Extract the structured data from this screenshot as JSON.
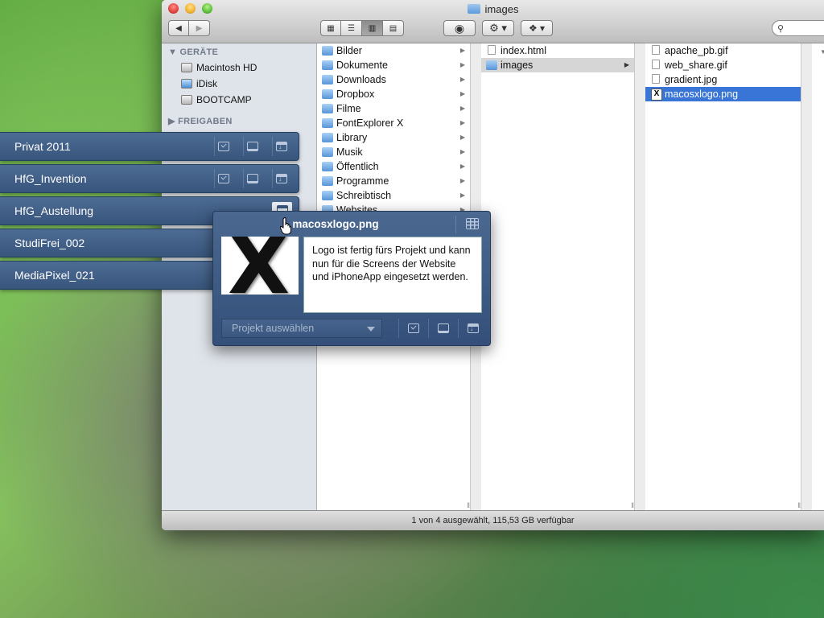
{
  "window": {
    "title": "images",
    "status": "1 von 4 ausgewählt, 115,53 GB verfügbar"
  },
  "sidebar": {
    "sections": [
      {
        "label": "GERÄTE",
        "items": [
          "Macintosh HD",
          "iDisk",
          "BOOTCAMP"
        ]
      },
      {
        "label": "FREIGABEN",
        "items": []
      }
    ]
  },
  "columns": [
    {
      "items": [
        "Bilder",
        "Dokumente",
        "Downloads",
        "Dropbox",
        "Filme",
        "FontExplorer X",
        "Library",
        "Musik",
        "Öffentlich",
        "Programme",
        "Schreibtisch",
        "Websites"
      ]
    },
    {
      "items": [
        "index.html",
        "images"
      ],
      "selected": "images"
    },
    {
      "items": [
        "apache_pb.gif",
        "web_share.gif",
        "gradient.jpg",
        "macosxlogo.png"
      ],
      "selected": "macosxlogo.png"
    }
  ],
  "projects": [
    "Privat 2011",
    "HfG_Invention",
    "HfG_Austellung",
    "StudiFrei_002",
    "MediaPixel_021"
  ],
  "popup": {
    "filename": "macosxlogo.png",
    "thumbnail_letter": "X",
    "note": "Logo ist fertig fürs Projekt und kann nun für die Screens der Website und iPhoneApp eingesetzt werden.",
    "select_placeholder": "Projekt auswählen"
  },
  "icons": {
    "project_actions": [
      "check-icon",
      "monitor-icon",
      "download-icon"
    ],
    "toolbar": [
      "back-icon",
      "forward-icon",
      "icon-view-icon",
      "list-view-icon",
      "column-view-icon",
      "coverflow-icon",
      "quicklook-eye-icon",
      "gear-icon",
      "dropbox-icon",
      "search-icon"
    ]
  },
  "colors": {
    "selection_blue": "#3875d7",
    "panel_blue": "#3f5e88"
  }
}
